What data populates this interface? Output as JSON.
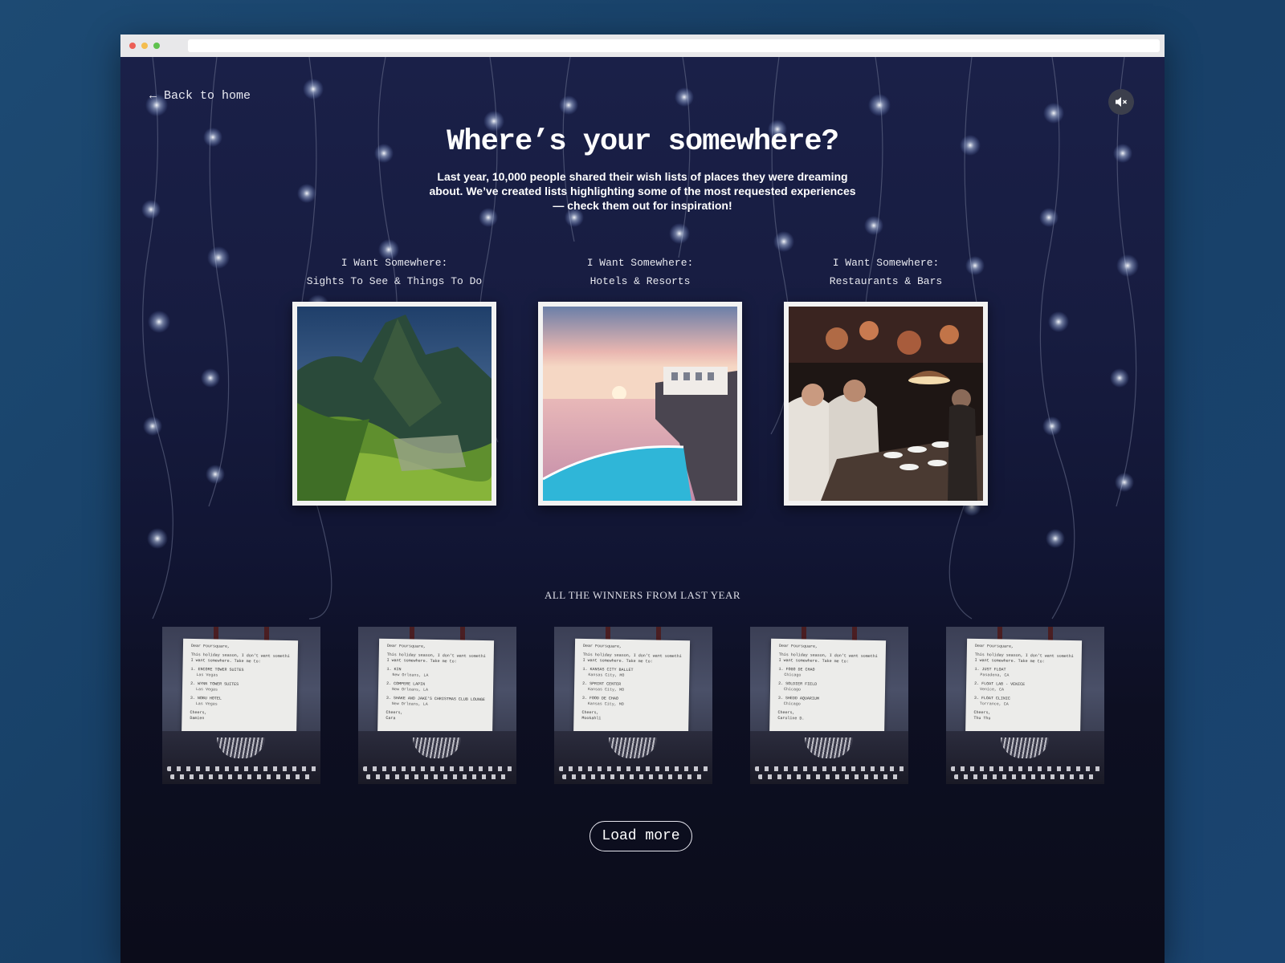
{
  "nav": {
    "back_label": "← Back to home"
  },
  "controls": {
    "mute_icon": "speaker-muted-icon"
  },
  "hero": {
    "title": "Where’s your somewhere?",
    "intro": "Last year, 10,000 people shared their wish lists of places they were dreaming about. We’ve created lists highlighting some of the most requested experiences — check them out for inspiration!"
  },
  "categories": [
    {
      "line1": "I Want Somewhere:",
      "line2": "Sights To See & Things To Do",
      "image": "machu-picchu-photo"
    },
    {
      "line1": "I Want Somewhere:",
      "line2": "Hotels & Resorts",
      "image": "cliffside-resort-pool-photo"
    },
    {
      "line1": "I Want Somewhere:",
      "line2": "Restaurants & Bars",
      "image": "restaurant-kitchen-chefs-photo"
    }
  ],
  "winners": {
    "heading": "ALL THE WINNERS FROM LAST YEAR",
    "letters": [
      {
        "greeting": "Dear Foursquare,",
        "body1": "This holiday season, I don't want something.",
        "body2": "I want somewhere. Take me to:",
        "items": [
          {
            "name": "1. ENCORE TOWER SUITES",
            "place": "Las Vegas"
          },
          {
            "name": "2. WYNN TOWER SUITES",
            "place": "Las Vegas"
          },
          {
            "name": "3. NOBU HOTEL",
            "place": "Las Vegas"
          }
        ],
        "closing": "Cheers,",
        "signature": "Damien"
      },
      {
        "greeting": "Dear Foursquare,",
        "body1": "This holiday season, I don't want something.",
        "body2": "I want somewhere. Take me to:",
        "items": [
          {
            "name": "1. KIN",
            "place": "New Orleans, LA"
          },
          {
            "name": "2. COMPERE LAPIN",
            "place": "New Orleans, LA"
          },
          {
            "name": "3. SHAKE AND JAKE'S CHRISTMAS CLUB LOUNGE",
            "place": "New Orleans, LA"
          }
        ],
        "closing": "Cheers,",
        "signature": "Cara"
      },
      {
        "greeting": "Dear Foursquare,",
        "body1": "This holiday season, I don't want something.",
        "body2": "I want somewhere. Take me to:",
        "items": [
          {
            "name": "1. KANSAS CITY BALLET",
            "place": "Kansas City, MO"
          },
          {
            "name": "2. SPRINT CENTER",
            "place": "Kansas City, MO"
          },
          {
            "name": "3. FOOD DE CHAO",
            "place": "Kansas City, MO"
          }
        ],
        "closing": "Cheers,",
        "signature": "Mookahli"
      },
      {
        "greeting": "Dear Foursquare,",
        "body1": "This holiday season, I don't want something.",
        "body2": "I want somewhere. Take me to:",
        "items": [
          {
            "name": "1. FOGO DE CHAO",
            "place": "Chicago"
          },
          {
            "name": "2. SOLDIER FIELD",
            "place": "Chicago"
          },
          {
            "name": "3. SHEDD AQUARIUM",
            "place": "Chicago"
          }
        ],
        "closing": "Cheers,",
        "signature": "Caroline D."
      },
      {
        "greeting": "Dear Foursquare,",
        "body1": "This holiday season, I don't want something.",
        "body2": "I want somewhere. Take me to:",
        "items": [
          {
            "name": "1. JUST FLOAT",
            "place": "Pasadena, CA"
          },
          {
            "name": "2. FLOAT LAB - VENICE",
            "place": "Venice, CA"
          },
          {
            "name": "3. FLOAT CLINIC",
            "place": "Torrance, CA"
          }
        ],
        "closing": "Cheers,",
        "signature": "Thu Thu"
      }
    ]
  },
  "pagination": {
    "load_more_label": "Load more"
  }
}
